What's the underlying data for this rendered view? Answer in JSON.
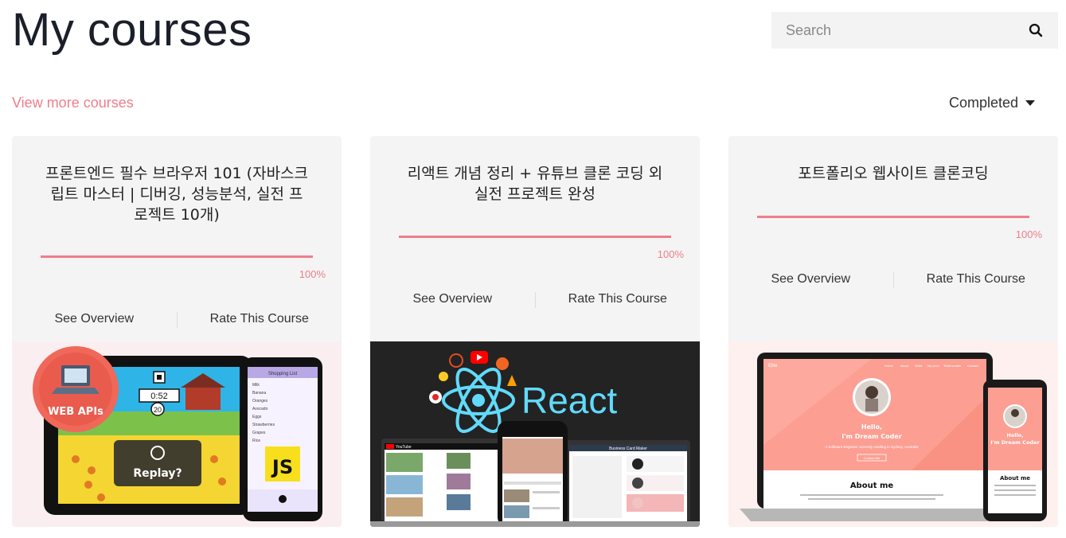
{
  "header": {
    "title": "My courses",
    "search_placeholder": "Search"
  },
  "toolbar": {
    "view_more": "View more courses",
    "filter": "Completed"
  },
  "courses": [
    {
      "title": "프론트엔드 필수 브라우저 101 (자바스크립트 마스터 | 디버깅, 성능분석, 실전 프로젝트 10개)",
      "progress_percent": 100,
      "progress_label": "100%",
      "overview_label": "See Overview",
      "rate_label": "Rate This Course",
      "image": {
        "badge": "WEB APIs",
        "timer": "0:52",
        "counter": "20",
        "replay": "Replay?",
        "phone_heading": "Shopping List",
        "phone_items": [
          "Milk",
          "Banana",
          "Oranges",
          "Avocado",
          "Eggs",
          "Strawberries",
          "Grapes",
          "Rice"
        ],
        "js_badge": "JS"
      }
    },
    {
      "title": "리액트 개념 정리 + 유튜브 클론 코딩 외 실전 프로젝트 완성",
      "progress_percent": 100,
      "progress_label": "100%",
      "overview_label": "See Overview",
      "rate_label": "Rate This Course",
      "image": {
        "logo_text": "React",
        "app_name": "YouTube",
        "business_card_title": "Business Card Maker"
      }
    },
    {
      "title": "포트폴리오 웹사이트 클론코딩",
      "progress_percent": 100,
      "progress_label": "100%",
      "overview_label": "See Overview",
      "rate_label": "Rate This Course",
      "image": {
        "hero_greeting": "Hello,",
        "hero_name": "I'm Dream Coder",
        "hero_subtitle": "A Software Engineer currently residing in Sydney, Australia",
        "hero_button": "Contact Me",
        "about_heading": "About me",
        "logo": "Ellie",
        "nav": [
          "Home",
          "About",
          "Skills",
          "My work",
          "Testimonials",
          "Contact"
        ]
      }
    }
  ],
  "colors": {
    "accent": "#ef7e8a",
    "card_bg": "#f4f4f4",
    "search_bg": "#f3f3f3",
    "react_blue": "#61dafb",
    "portfolio_pink": "#fc9e92"
  }
}
